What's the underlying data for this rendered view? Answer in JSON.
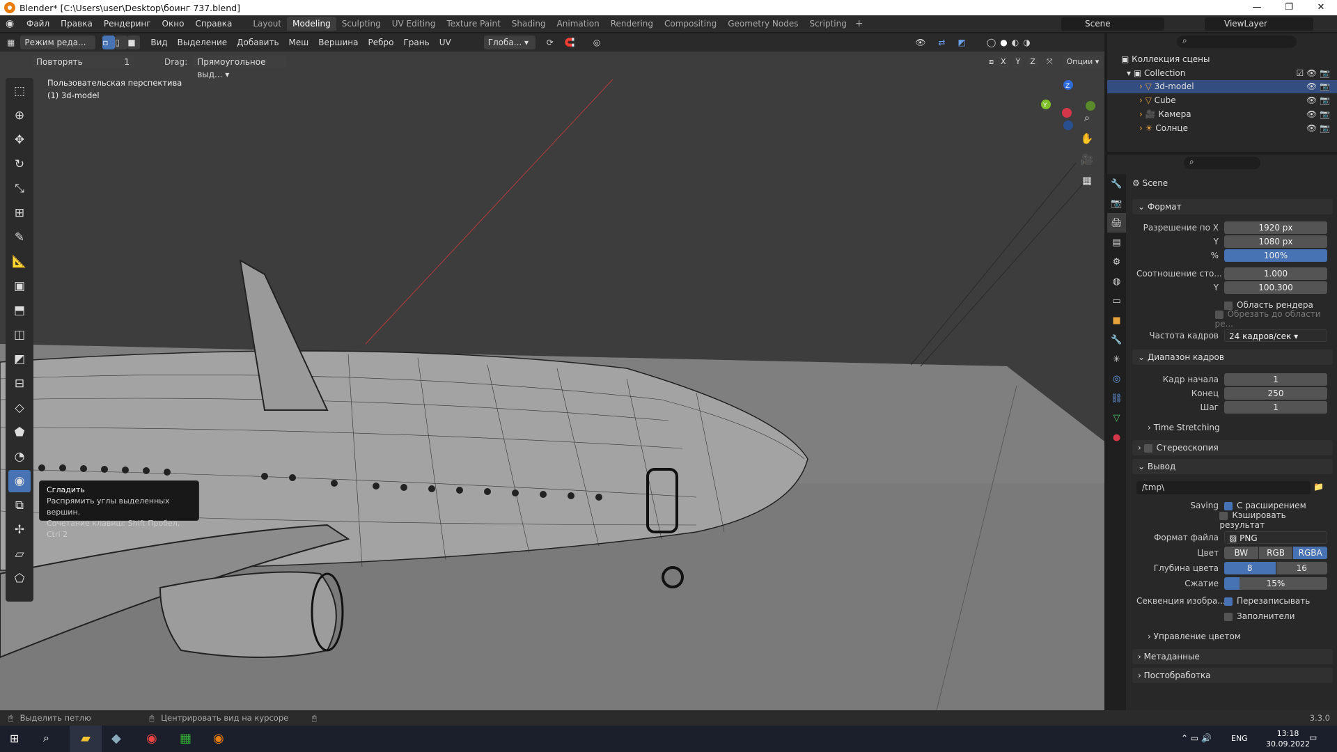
{
  "window": {
    "title": "Blender* [C:\\Users\\user\\Desktop\\боинг 737.blend]"
  },
  "menu": [
    "Файл",
    "Правка",
    "Рендеринг",
    "Окно",
    "Справка"
  ],
  "workspaces": [
    {
      "label": "Layout"
    },
    {
      "label": "Modeling",
      "active": true
    },
    {
      "label": "Sculpting"
    },
    {
      "label": "UV Editing"
    },
    {
      "label": "Texture Paint"
    },
    {
      "label": "Shading"
    },
    {
      "label": "Animation"
    },
    {
      "label": "Rendering"
    },
    {
      "label": "Compositing"
    },
    {
      "label": "Geometry Nodes"
    },
    {
      "label": "Scripting"
    }
  ],
  "scene": {
    "name": "Scene"
  },
  "viewlayer": {
    "name": "ViewLayer"
  },
  "viewport_header": {
    "mode": "Режим реда...",
    "menus": [
      "Вид",
      "Выделение",
      "Добавить",
      "Меш",
      "Вершина",
      "Ребро",
      "Грань",
      "UV"
    ],
    "orientation": "Глоба...",
    "options": "Опции",
    "axes": [
      "X",
      "Y",
      "Z"
    ]
  },
  "last_op": {
    "label": "Повторять",
    "value": "1",
    "drag_label": "Drag:",
    "drag_value": "Прямоугольное выд..."
  },
  "viewport": {
    "view_name": "Пользовательская перспектива",
    "object_name": "(1) 3d-model"
  },
  "tooltip": {
    "title": "Сгладить",
    "desc": "Распрямить углы выделенных вершин.",
    "shortcut": "Сочетание клавиш: Shift Пробел, Ctrl 2"
  },
  "outliner": {
    "root": "Коллекция сцены",
    "collection": "Collection",
    "items": [
      {
        "name": "3d-model",
        "selected": true
      },
      {
        "name": "Cube"
      },
      {
        "name": "Камера"
      },
      {
        "name": "Солнце"
      }
    ]
  },
  "properties": {
    "context": "Scene",
    "format": {
      "title": "Формат",
      "res_x_label": "Разрешение по X",
      "res_x": "1920 px",
      "res_y_label": "Y",
      "res_y": "1080 px",
      "pct_label": "%",
      "pct": "100%",
      "aspect_label": "Соотношение сто...",
      "aspect_x": "1.000",
      "aspect_y_label": "Y",
      "aspect_y": "100.300",
      "render_region": "Область рендера",
      "crop": "Обрезать до области ре...",
      "fps_label": "Частота кадров",
      "fps": "24 кадров/сек"
    },
    "frame_range": {
      "title": "Диапазон кадров",
      "start_label": "Кадр начала",
      "start": "1",
      "end_label": "Конец",
      "end": "250",
      "step_label": "Шаг",
      "step": "1",
      "time_stretching": "Time Stretching"
    },
    "stereo": "Стереоскопия",
    "output": {
      "title": "Вывод",
      "path": "/tmp\\",
      "saving_label": "Saving",
      "ext": "С расширением",
      "cache": "Кэшировать результат",
      "file_format_label": "Формат файла",
      "file_format": "PNG",
      "color_label": "Цвет",
      "color_opts": [
        "BW",
        "RGB",
        "RGBA"
      ],
      "depth_label": "Глубина цвета",
      "depth_opts": [
        "8",
        "16"
      ],
      "compress_label": "Сжатие",
      "compress": "15%",
      "seq_label": "Секвенция изобра...",
      "overwrite": "Перезаписывать",
      "placeholders": "Заполнители",
      "color_mgmt": "Управление цветом"
    },
    "metadata": "Метаданные",
    "postprocessing": "Постобработка"
  },
  "status": {
    "left": "Выделить петлю",
    "mid": "Центрировать вид на курсоре",
    "version": "3.3.0"
  },
  "taskbar": {
    "lang": "ENG",
    "time": "13:18",
    "date": "30.09.2022"
  }
}
